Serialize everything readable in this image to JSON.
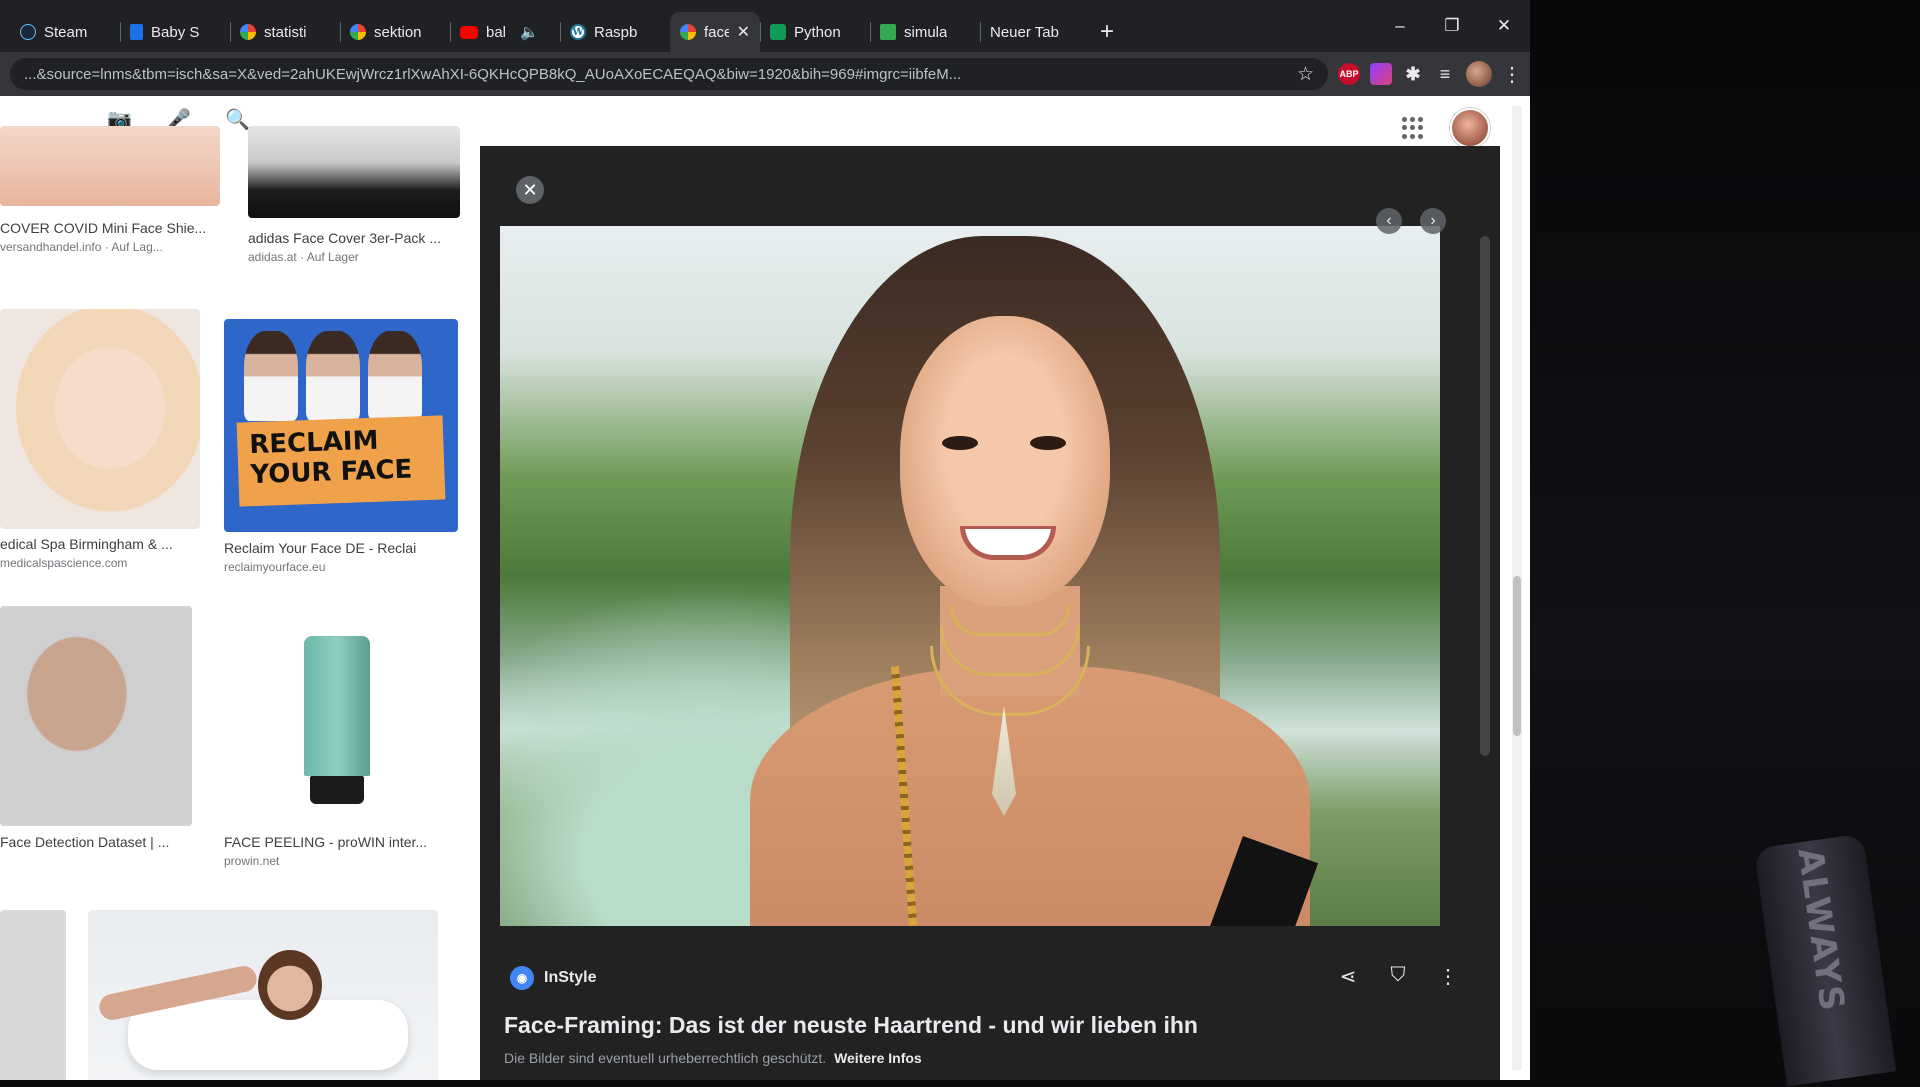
{
  "browser": {
    "tabs": [
      {
        "label": "Steam",
        "icon": "steam-icon"
      },
      {
        "label": "Baby S",
        "icon": "doc-icon"
      },
      {
        "label": "statisti",
        "icon": "google-icon"
      },
      {
        "label": "sektion",
        "icon": "google-icon"
      },
      {
        "label": "bal",
        "icon": "youtube-icon"
      },
      {
        "label": "Raspb",
        "icon": "wordpress-icon"
      },
      {
        "label": "face",
        "icon": "google-icon",
        "active": true
      },
      {
        "label": "Python",
        "icon": "python-icon"
      },
      {
        "label": "simula",
        "icon": "sim-icon"
      },
      {
        "label": "Neuer Tab",
        "icon": ""
      }
    ],
    "new_tab": "+",
    "window_controls": {
      "minimize": "–",
      "restore": "❐",
      "close": "✕"
    },
    "url": "...&source=lnms&tbm=isch&sa=X&ved=2ahUKEwjWrcz1rlXwAhXI-6QKHcQPB8kQ_AUoAXoECAEQAQ&biw=1920&bih=969#imgrc=iibfeM...",
    "extensions": [
      "ABP",
      "grad-ext",
      "puzzle-icon",
      "media-icon"
    ]
  },
  "search": {
    "camera": "📷",
    "mic": "🎤",
    "search": "🔍"
  },
  "thumbnails": [
    {
      "title": "COVER COVID Mini Face Shie...",
      "source": "versandhandel.info · Auf Lag..."
    },
    {
      "title": "adidas Face Cover 3er-Pack ...",
      "source": "adidas.at · Auf Lager"
    },
    {
      "title": "edical Spa Birmingham & ...",
      "source": "medicalspascience.com"
    },
    {
      "title": "Reclaim Your Face DE - Reclai",
      "source": "reclaimyourface.eu"
    },
    {
      "title": "Face Detection Dataset | ...",
      "source": ""
    },
    {
      "title": "FACE PEELING - proWIN inter...",
      "source": "prowin.net"
    }
  ],
  "reclaim": {
    "line1": "RECLAIM",
    "line2": "YOUR FACE"
  },
  "preview": {
    "source_name": "InStyle",
    "title": "Face-Framing: Das ist der neuste Haartrend - und wir lieben ihn",
    "copyright": "Die Bilder sind eventuell urheberrechtlich geschützt.",
    "more_info": "Weitere Infos",
    "close": "✕",
    "prev": "‹",
    "next": "›"
  },
  "desk": {
    "cable_text": "ALWAYS"
  }
}
